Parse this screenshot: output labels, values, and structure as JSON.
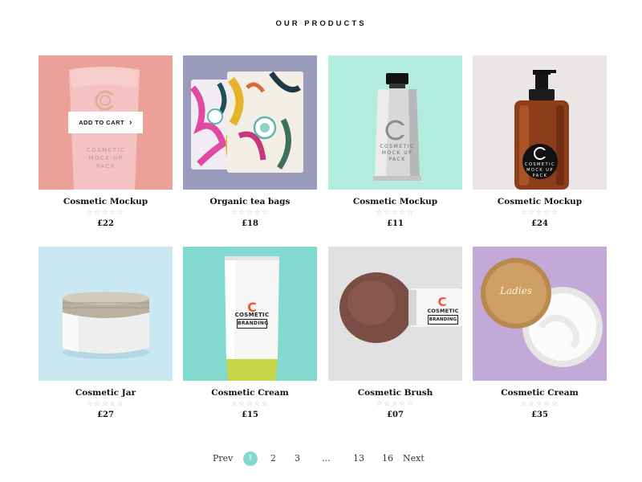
{
  "section_title": "OUR PRODUCTS",
  "add_to_cart": "ADD TO CART",
  "products": [
    {
      "name": "Cosmetic Mockup",
      "price": "£22",
      "rating": "☆☆☆☆☆",
      "bg": "#eba198",
      "label": "COSMETIC\nMOCK UP\nPACK"
    },
    {
      "name": "Organic tea bags",
      "price": "£18",
      "rating": "☆☆☆☆☆",
      "bg": "#9b9cbd"
    },
    {
      "name": "Cosmetic Mockup",
      "price": "£11",
      "rating": "☆☆☆☆☆",
      "bg": "#b2ecdf",
      "label": "COSMETIC\nMOCK UP\nPACK"
    },
    {
      "name": "Cosmetic Mockup",
      "price": "£24",
      "rating": "☆☆☆☆☆",
      "bg": "#eae6e5",
      "label": "COSMETIC\nMOCK UP\nPACK"
    },
    {
      "name": "Cosmetic Jar",
      "price": "£27",
      "rating": "☆☆☆☆☆",
      "bg": "#c9e8f2"
    },
    {
      "name": "Cosmetic Cream",
      "price": "£15",
      "rating": "☆☆☆☆☆",
      "bg": "#82d9cf",
      "label": "COSMETIC",
      "label2": "BRANDING"
    },
    {
      "name": "Cosmetic Brush",
      "price": "£07",
      "rating": "☆☆☆☆☆",
      "bg": "#e2e1e2",
      "label": "COSMETIC",
      "label2": "BRANDING"
    },
    {
      "name": "Cosmetic Cream",
      "price": "£35",
      "rating": "☆☆☆☆☆",
      "bg": "#c3a9d8",
      "label": "Ladies"
    }
  ],
  "pagination": {
    "prev": "Prev",
    "pages": [
      "1",
      "2",
      "3",
      "...",
      "13",
      "16"
    ],
    "current": "1",
    "next": "Next"
  },
  "colors": {
    "accent": "#82d9cf",
    "star": "#d9a7d6"
  }
}
